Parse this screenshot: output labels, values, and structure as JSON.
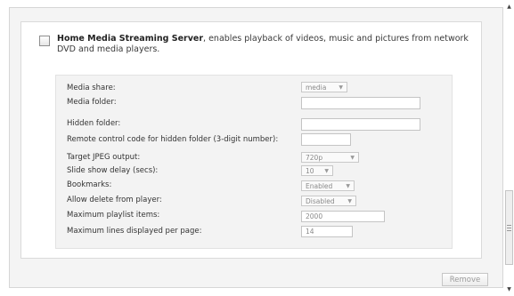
{
  "section": {
    "title_bold": "Home Media Streaming Server",
    "title_rest": ", enables playback of videos, music and pictures from network DVD and media players."
  },
  "fields": [
    {
      "label": "Media share:",
      "value": "media"
    },
    {
      "label": "Media folder:",
      "value": ""
    },
    {
      "label": "Hidden folder:",
      "value": ""
    },
    {
      "label": "Remote control code for hidden folder (3-digit number):",
      "value": ""
    },
    {
      "label": "Target JPEG output:",
      "value": "720p"
    },
    {
      "label": "Slide show delay (secs):",
      "value": "10"
    },
    {
      "label": "Bookmarks:",
      "value": "Enabled"
    },
    {
      "label": "Allow delete from player:",
      "value": "Disabled"
    },
    {
      "label": "Maximum playlist items:",
      "value": "2000"
    },
    {
      "label": "Maximum lines displayed per page:",
      "value": "14"
    }
  ],
  "buttons": {
    "remove": "Remove"
  },
  "icons": {
    "dropdown": "chevron-down-icon",
    "scroll_up": "arrow-up-icon",
    "scroll_down": "arrow-down-icon"
  }
}
